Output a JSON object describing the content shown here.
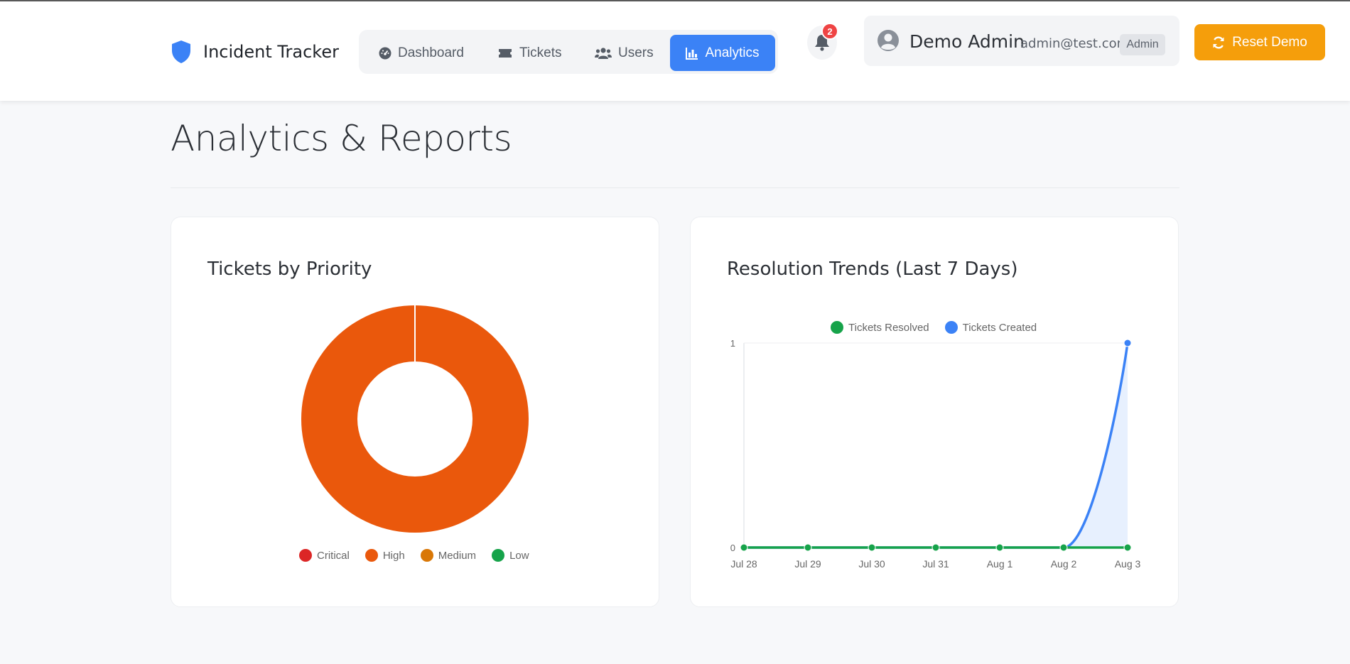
{
  "brand": {
    "name": "Incident Tracker",
    "icon": "shield-icon",
    "color": "#3b82f6"
  },
  "nav": {
    "items": [
      {
        "label": "Dashboard",
        "icon": "gauge-icon"
      },
      {
        "label": "Tickets",
        "icon": "ticket-icon"
      },
      {
        "label": "Users",
        "icon": "users-icon"
      },
      {
        "label": "Analytics",
        "icon": "chart-bar-icon",
        "active": true
      }
    ]
  },
  "notifications": {
    "icon": "bell-icon",
    "count": "2"
  },
  "user": {
    "name": "Demo Admin",
    "email": "admin@test.com",
    "role": "Admin",
    "icon": "user-circle-icon"
  },
  "actions": {
    "reset_label": "Reset Demo",
    "reset_icon": "refresh-icon",
    "reset_color": "#f59e0b"
  },
  "page": {
    "title": "Analytics & Reports"
  },
  "cards": {
    "priority": {
      "title": "Tickets by Priority"
    },
    "trends": {
      "title": "Resolution Trends (Last 7 Days)"
    }
  },
  "chart_data": [
    {
      "type": "pie",
      "variant": "doughnut",
      "title": "Tickets by Priority",
      "categories": [
        "Critical",
        "High",
        "Medium",
        "Low"
      ],
      "values": [
        0,
        1,
        0,
        0
      ],
      "colors": [
        "#dc2626",
        "#ea580c",
        "#d97706",
        "#16a34a"
      ],
      "legend": "bottom"
    },
    {
      "type": "line",
      "title": "Resolution Trends (Last 7 Days)",
      "x": [
        "Jul 28",
        "Jul 29",
        "Jul 30",
        "Jul 31",
        "Aug 1",
        "Aug 2",
        "Aug 3"
      ],
      "series": [
        {
          "name": "Tickets Resolved",
          "values": [
            0,
            0,
            0,
            0,
            0,
            0,
            0
          ],
          "color": "#16a34a"
        },
        {
          "name": "Tickets Created",
          "values": [
            0,
            0,
            0,
            0,
            0,
            0,
            1
          ],
          "color": "#3b82f6",
          "fill": true
        }
      ],
      "ylim": [
        0,
        1
      ],
      "yticks": [
        "0",
        "1"
      ],
      "legend": "top",
      "grid": false
    }
  ]
}
